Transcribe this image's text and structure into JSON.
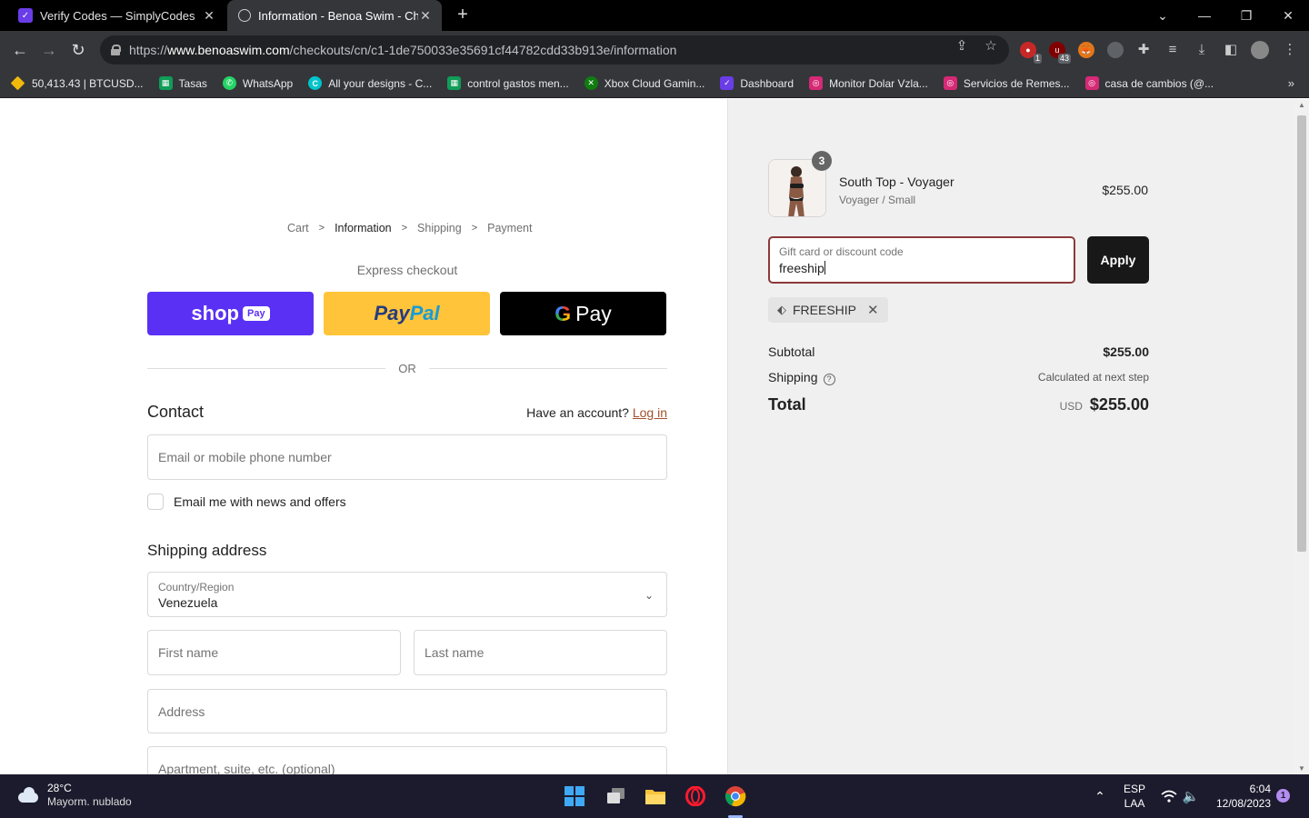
{
  "browser": {
    "tabs": [
      {
        "title": "Verify Codes — SimplyCodes",
        "active": false
      },
      {
        "title": "Information - Benoa Swim - Checkout",
        "active": true
      }
    ],
    "url_scheme": "https://",
    "url_host": "www.benoaswim.com",
    "url_path": "/checkouts/cn/c1-1de750033e35691cf44782cdd33b913e/information",
    "extensions": [
      {
        "icon": "shield-extension-icon",
        "badge": "1",
        "color": "#c62828"
      },
      {
        "icon": "ublock-icon",
        "badge": "43",
        "color": "#800000"
      },
      {
        "icon": "metamask-icon",
        "badge": "",
        "color": "#e2761b"
      },
      {
        "icon": "robot-extension-icon",
        "badge": "",
        "color": "#5f6368"
      }
    ],
    "bookmarks": [
      {
        "label": "50,413.43 | BTCUSD...",
        "icon": "binance-icon",
        "color": "#f0b90b"
      },
      {
        "label": "Tasas",
        "icon": "sheets-icon",
        "color": "#0f9d58"
      },
      {
        "label": "WhatsApp",
        "icon": "whatsapp-icon",
        "color": "#25d366"
      },
      {
        "label": "All your designs - C...",
        "icon": "canva-icon",
        "color": "#00c4cc"
      },
      {
        "label": "control gastos men...",
        "icon": "sheets-icon",
        "color": "#0f9d58"
      },
      {
        "label": "Xbox Cloud Gamin...",
        "icon": "xbox-icon",
        "color": "#107c10"
      },
      {
        "label": "Dashboard",
        "icon": "simplycodes-icon",
        "color": "#6a3de8"
      },
      {
        "label": "Monitor Dolar Vzla...",
        "icon": "instagram-icon",
        "color": "#d62976"
      },
      {
        "label": "Servicios de Remes...",
        "icon": "instagram-icon",
        "color": "#d62976"
      },
      {
        "label": "casa de cambios (@...",
        "icon": "instagram-icon",
        "color": "#d62976"
      }
    ]
  },
  "checkout": {
    "breadcrumbs": [
      "Cart",
      "Information",
      "Shipping",
      "Payment"
    ],
    "express_checkout": "Express checkout",
    "shop_pay": "shop",
    "shop_pay_pill": "Pay",
    "paypal_1": "Pay",
    "paypal_2": "Pal",
    "gpay_g": "G",
    "gpay_text": "Pay",
    "or": "OR",
    "contact_title": "Contact",
    "have_account": "Have an account?",
    "login": "Log in",
    "email_placeholder": "Email or mobile phone number",
    "news_offers": "Email me with news and offers",
    "shipping_title": "Shipping address",
    "country_label": "Country/Region",
    "country_value": "Venezuela",
    "first_name": "First name",
    "last_name": "Last name",
    "address": "Address",
    "apartment": "Apartment, suite, etc. (optional)"
  },
  "summary": {
    "product_name": "South Top - Voyager",
    "product_variant": "Voyager / Small",
    "product_price": "$255.00",
    "quantity": "3",
    "discount_label": "Gift card or discount code",
    "discount_value": "freeship",
    "apply": "Apply",
    "applied_code": "FREESHIP",
    "subtotal_label": "Subtotal",
    "subtotal_value": "$255.00",
    "shipping_label": "Shipping",
    "shipping_value": "Calculated at next step",
    "total_label": "Total",
    "currency": "USD",
    "total_value": "$255.00"
  },
  "taskbar": {
    "temperature": "28°C",
    "weather": "Mayorm. nublado",
    "lang_1": "ESP",
    "lang_2": "LAA",
    "time": "6:04",
    "date": "12/08/2023",
    "notifications": "1"
  }
}
